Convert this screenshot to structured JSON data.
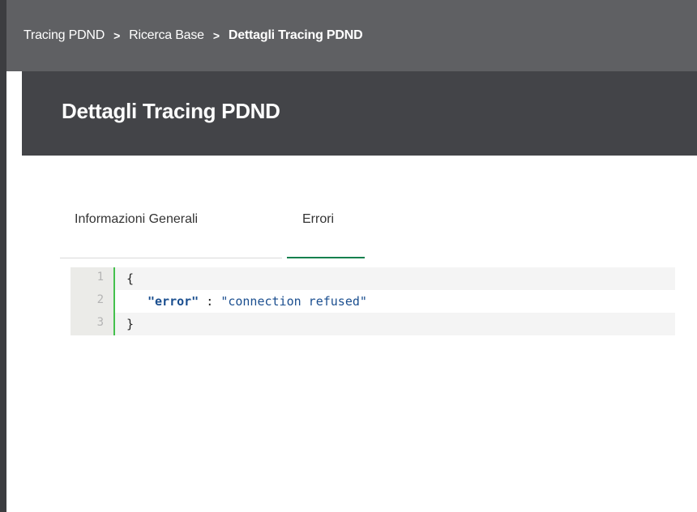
{
  "breadcrumb": {
    "items": [
      "Tracing PDND",
      "Ricerca Base"
    ],
    "current": "Dettagli Tracing PDND",
    "separator": ">"
  },
  "page": {
    "title": "Dettagli Tracing PDND"
  },
  "tabs": [
    {
      "label": "Informazioni Generali",
      "active": false
    },
    {
      "label": "Errori",
      "active": true
    }
  ],
  "code_editor": {
    "line_numbers": [
      "1",
      "2",
      "3"
    ],
    "lines": [
      {
        "open": "{"
      },
      {
        "key": "\"error\"",
        "colon": " : ",
        "value": "\"connection refused\""
      },
      {
        "close": "}"
      }
    ]
  },
  "colors": {
    "breadcrumb_bg": "#5f6063",
    "title_bg": "#434448",
    "tab_active_underline": "#13804e",
    "gutter_marker": "#44c14d",
    "json_token": "#1a4e8f"
  }
}
